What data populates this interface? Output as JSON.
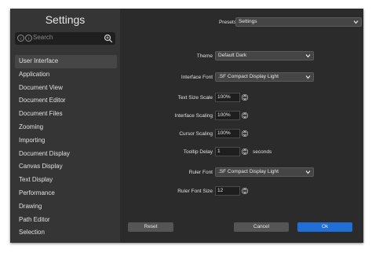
{
  "sidebar": {
    "title": "Settings",
    "search_placeholder": "Search",
    "items": [
      {
        "label": "User Interface"
      },
      {
        "label": "Application"
      },
      {
        "label": "Document View"
      },
      {
        "label": "Document Editor"
      },
      {
        "label": "Document Files"
      },
      {
        "label": "Zooming"
      },
      {
        "label": "Importing"
      },
      {
        "label": "Document Display"
      },
      {
        "label": "Canvas Display"
      },
      {
        "label": "Text Display"
      },
      {
        "label": "Performance"
      },
      {
        "label": "Drawing"
      },
      {
        "label": "Path Editor"
      },
      {
        "label": "Selection"
      }
    ],
    "active_item": "User Interface"
  },
  "presets": {
    "label": "Presets",
    "value": "Settings"
  },
  "fields": {
    "theme": {
      "label": "Theme",
      "value": "Default Dark"
    },
    "interface_font": {
      "label": "Interface Font",
      "value": ".SF Compact Display Light"
    },
    "text_size_scale": {
      "label": "Text Size Scale",
      "value": "100%"
    },
    "interface_scaling": {
      "label": "Interface Scaling",
      "value": "100%"
    },
    "cursor_scaling": {
      "label": "Cursor Scaling",
      "value": "100%"
    },
    "tooltip_delay": {
      "label": "Tooltip Delay",
      "value": "1",
      "units": "seconds"
    },
    "ruler_font": {
      "label": "Ruler Font",
      "value": ".SF Compact Display Light"
    },
    "ruler_font_size": {
      "label": "Ruler Font Size",
      "value": "12"
    }
  },
  "buttons": {
    "reset": "Reset",
    "cancel": "Cancel",
    "ok": "Ok"
  },
  "colors": {
    "accent": "#1f6fd6",
    "window_bg": "#2b2b2b",
    "sidebar_bg": "#353535"
  }
}
